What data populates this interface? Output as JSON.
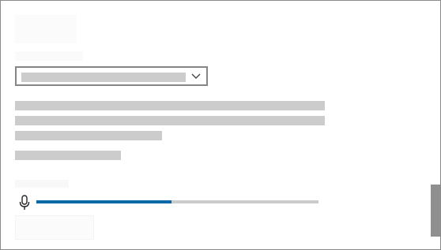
{
  "panel": {
    "heading": "",
    "device_label": "",
    "device_select": {
      "selected": ""
    },
    "description_lines": [
      "",
      "",
      ""
    ],
    "info_line": "",
    "level_label": "",
    "meter": {
      "level_percent": 48,
      "fill_color": "#0a6aa8",
      "track_color": "#cccccc"
    },
    "action_button_label": ""
  },
  "icons": {
    "select_chevron": "chevron-down-icon",
    "meter_icon": "microphone-icon"
  },
  "scrollbar": {
    "thumb_color": "#8f8f8f"
  }
}
